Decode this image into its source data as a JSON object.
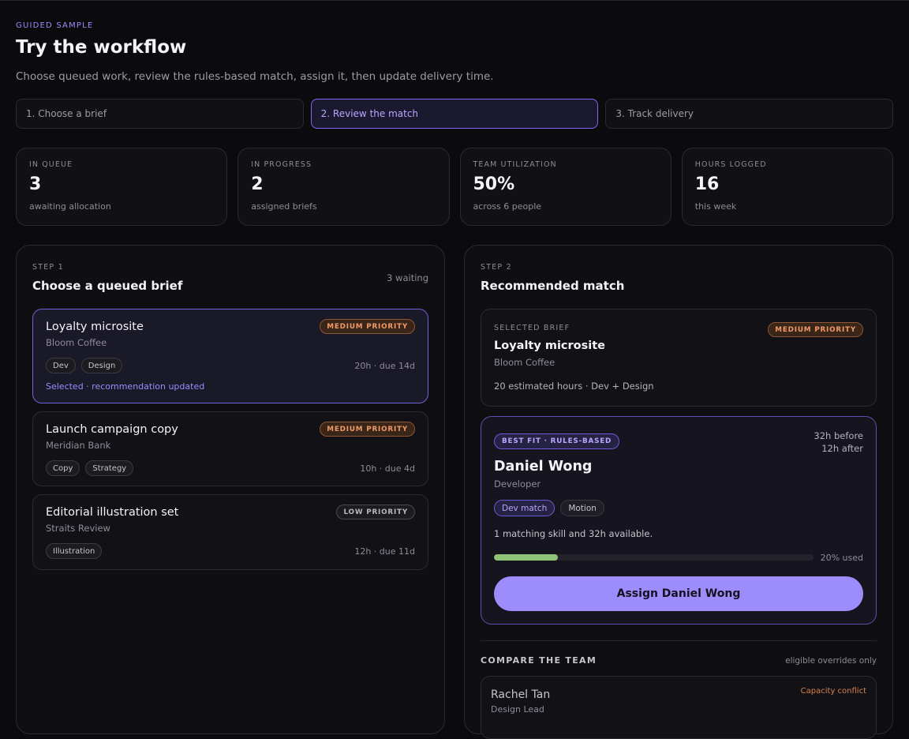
{
  "header": {
    "eyebrow": "GUIDED SAMPLE",
    "title": "Try the workflow",
    "subtitle": "Choose queued work, review the rules-based match, assign it, then update delivery time."
  },
  "steps": [
    {
      "label": "1.  Choose a brief",
      "active": false
    },
    {
      "label": "2.  Review the match",
      "active": true
    },
    {
      "label": "3.  Track delivery",
      "active": false
    }
  ],
  "stats": [
    {
      "label": "IN QUEUE",
      "value": "3",
      "sub": "awaiting allocation"
    },
    {
      "label": "IN PROGRESS",
      "value": "2",
      "sub": "assigned briefs"
    },
    {
      "label": "TEAM UTILIZATION",
      "value": "50%",
      "sub": "across 6 people"
    },
    {
      "label": "HOURS LOGGED",
      "value": "16",
      "sub": "this week"
    }
  ],
  "queue": {
    "eyebrow": "STEP 1",
    "title": "Choose a queued brief",
    "waiting": "3 waiting",
    "briefs": [
      {
        "name": "Loyalty microsite",
        "client": "Bloom Coffee",
        "priority": "MEDIUM PRIORITY",
        "tags": [
          "Dev",
          "Design"
        ],
        "meta": "20h · due 14d",
        "note": "Selected · recommendation updated"
      },
      {
        "name": "Launch campaign copy",
        "client": "Meridian Bank",
        "priority": "MEDIUM PRIORITY",
        "tags": [
          "Copy",
          "Strategy"
        ],
        "meta": "10h · due 4d"
      },
      {
        "name": "Editorial illustration set",
        "client": "Straits Review",
        "priority": "LOW PRIORITY",
        "tags": [
          "Illustration"
        ],
        "meta": "12h · due 11d"
      }
    ]
  },
  "match": {
    "eyebrow": "STEP 2",
    "title": "Recommended match",
    "selected": {
      "eyebrow": "SELECTED BRIEF",
      "name": "Loyalty microsite",
      "client": "Bloom Coffee",
      "priority": "MEDIUM PRIORITY",
      "estimate": "20 estimated hours · Dev + Design"
    },
    "candidate": {
      "badge": "BEST FIT · RULES-BASED",
      "hours_before": "32h before",
      "hours_after": "12h after",
      "name": "Daniel Wong",
      "role": "Developer",
      "skills": [
        "Dev match",
        "Motion"
      ],
      "description": "1 matching skill and 32h available.",
      "utilization_fraction": 0.2,
      "utilization_label": "20% used",
      "assign_label": "Assign Daniel Wong"
    },
    "compare": {
      "title": "COMPARE THE TEAM",
      "note": "eligible overrides only",
      "people": [
        {
          "name": "Rachel Tan",
          "role": "Design Lead",
          "status": "Capacity conflict"
        }
      ]
    }
  },
  "colors": {
    "accent": "#9d8dfb",
    "medium_priority": "#f09a66",
    "progress": "#8fc478",
    "conflict": "#d9814c"
  }
}
